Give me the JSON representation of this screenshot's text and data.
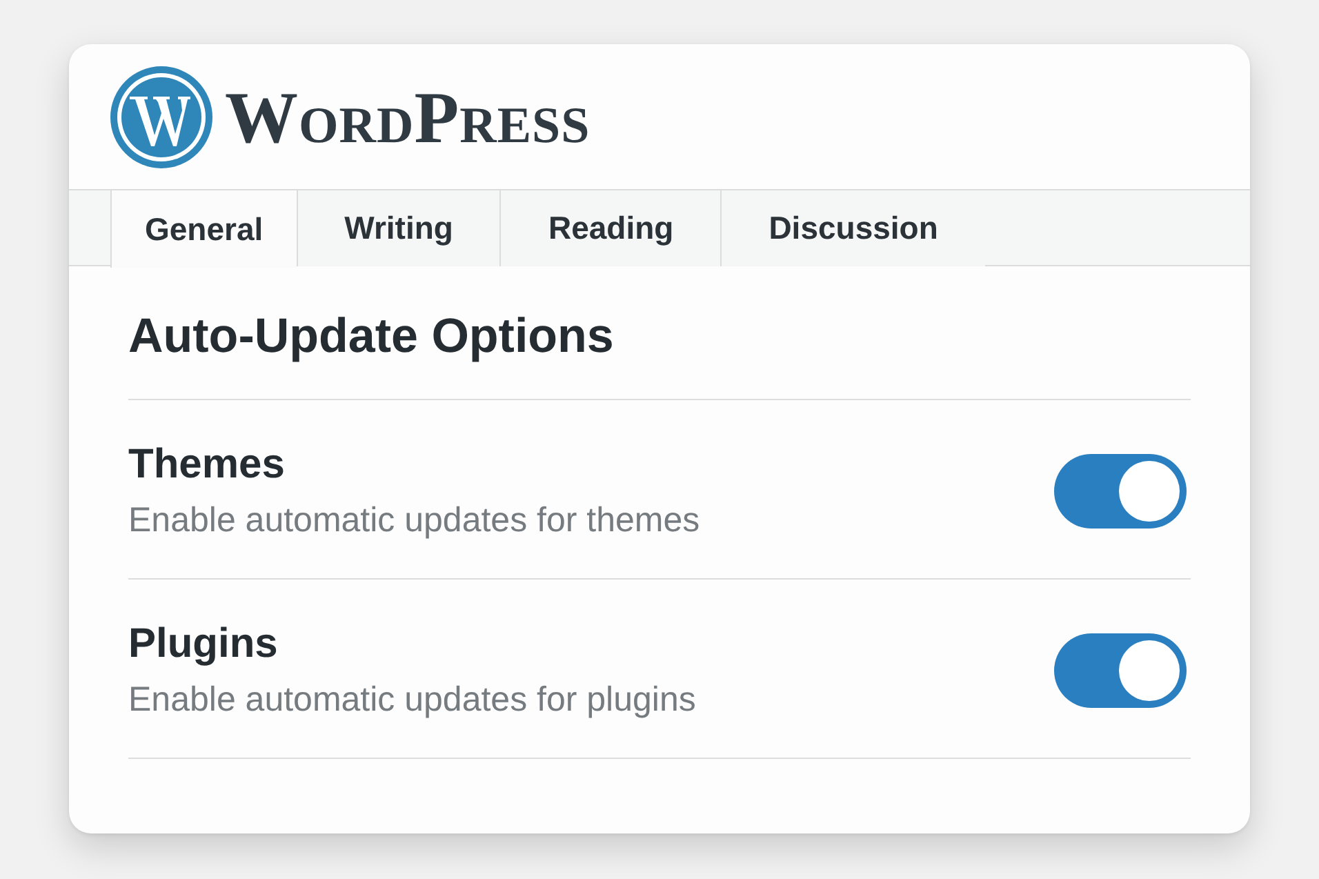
{
  "logo": {
    "text": "WordPress"
  },
  "tabs": [
    {
      "label": "General",
      "selected": true
    },
    {
      "label": "Writing",
      "selected": false
    },
    {
      "label": "Reading",
      "selected": false
    },
    {
      "label": "Discussion",
      "selected": false
    }
  ],
  "section": {
    "title": "Auto-Update Options"
  },
  "options": [
    {
      "title": "Themes",
      "description": "Enable automatic updates for themes",
      "on": true
    },
    {
      "title": "Plugins",
      "description": "Enable automatic updates for plugins",
      "on": true
    }
  ]
}
